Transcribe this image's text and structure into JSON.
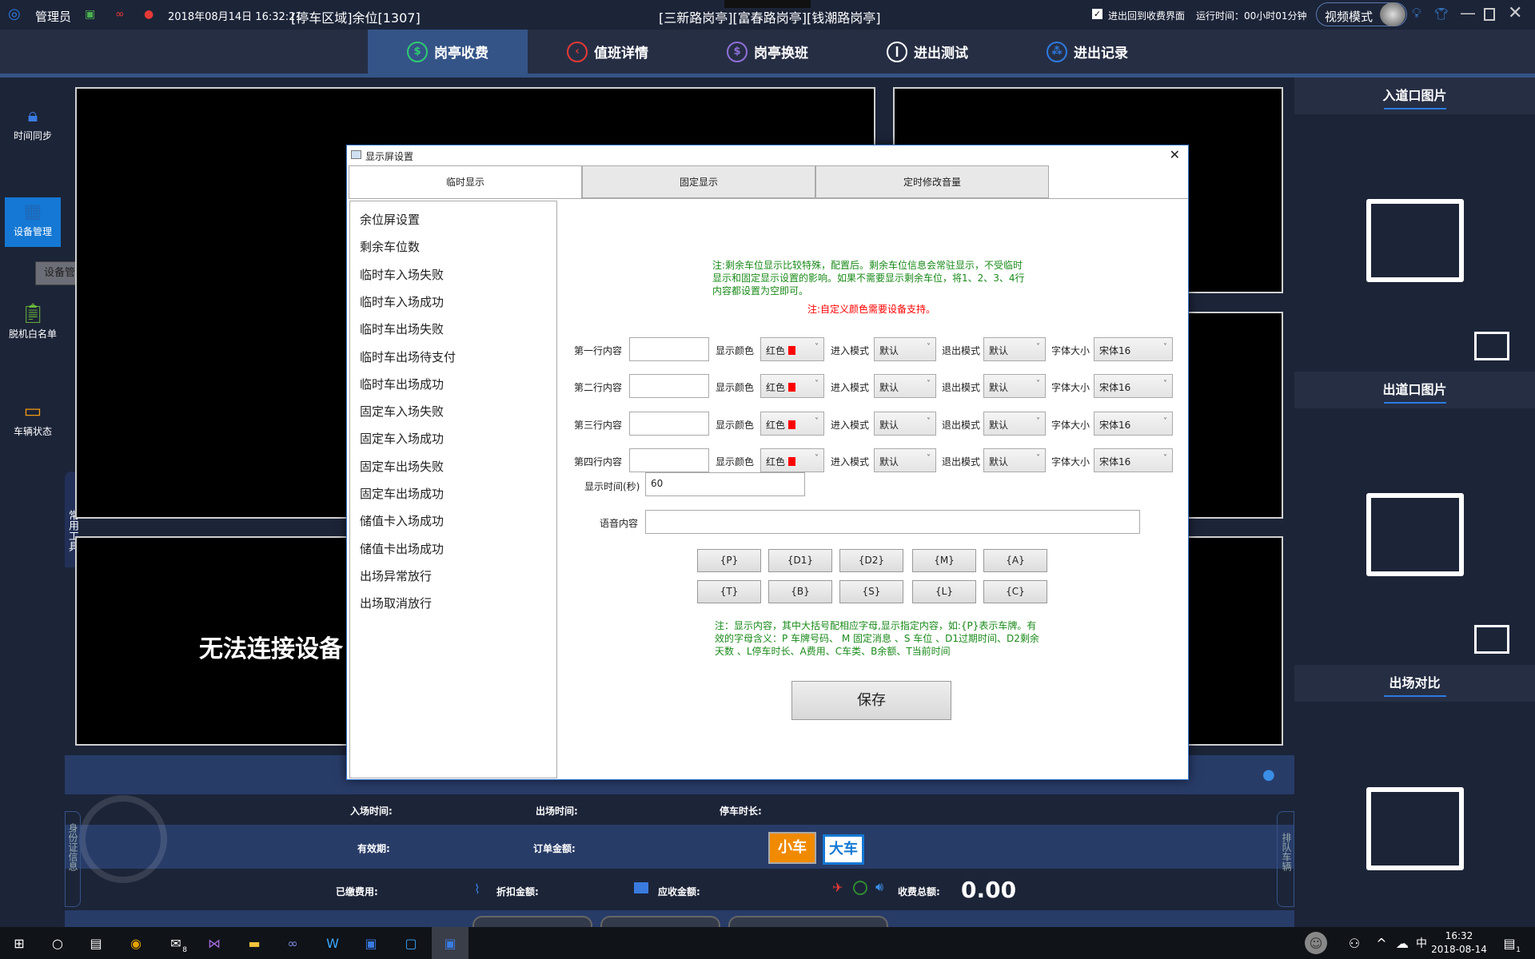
{
  "topbar": {
    "user": "管理员",
    "datetime": "2018年08月14日 16:32:21",
    "area": "[停车区域]余位[1307]",
    "booths": "[三新路岗亭][富春路岗亭][钱潮路岗亭]",
    "return_checkbox": "进出回到收费界面",
    "return_checked": true,
    "runtime": "运行时间：00小时01分钟",
    "mode": "视频模式"
  },
  "nav": {
    "tabs": [
      {
        "label": "岗亭收费",
        "color": "#2ecc71",
        "active": true
      },
      {
        "label": "值班详情",
        "color": "#e53935"
      },
      {
        "label": "岗亭换班",
        "color": "#8e6fd8"
      },
      {
        "label": "进出测试",
        "color": "#ffffff"
      },
      {
        "label": "进出记录",
        "color": "#2d7be0"
      }
    ]
  },
  "sidebar": {
    "items": [
      {
        "label": "时间同步",
        "icon": "lock-clock-icon"
      },
      {
        "label": "设备管理",
        "icon": "device-icon",
        "active": true
      },
      {
        "label": "脱机白名单",
        "icon": "clipboard-check-icon"
      },
      {
        "label": "车辆状态",
        "icon": "card-icon"
      }
    ],
    "tooltip": "设备管理",
    "tools_tab": "常用工具"
  },
  "video": {
    "status": "无法连接设备"
  },
  "rightpanel": {
    "entry": "入道口图片",
    "exit": "出道口图片",
    "compare": "出场对比"
  },
  "bottom": {
    "entry_time": "入场时间:",
    "exit_time": "出场时间:",
    "duration": "停车时长:",
    "validity": "有效期:",
    "order_amount": "订单金额:",
    "small_car": "小车",
    "large_car": "大车",
    "paid": "已缴费用:",
    "discount": "折扣金额:",
    "receivable": "应收金额:",
    "total_label": "收费总额:",
    "total_value": "0.00",
    "id_tab": "身份证信息",
    "queue_tab": "排队车辆"
  },
  "dialog": {
    "title": "显示屏设置",
    "tabs": [
      "临时显示",
      "固定显示",
      "定时修改音量"
    ],
    "list": [
      "余位屏设置",
      "剩余车位数",
      "临时车入场失败",
      "临时车入场成功",
      "临时车出场失败",
      "临时车出场待支付",
      "临时车出场成功",
      "固定车入场失败",
      "固定车入场成功",
      "固定车出场失败",
      "固定车出场成功",
      "储值卡入场成功",
      "储值卡出场成功",
      "出场异常放行",
      "出场取消放行"
    ],
    "note1": "注:剩余车位显示比较特殊，配置后。剩余车位信息会常驻显示，不受临时显示和固定显示设置的影响。如果不需要显示剩余车位，将1、2、3、4行内容都设置为空即可。",
    "note_red": "注:自定义颜色需要设备支持。",
    "rows": [
      {
        "label": "第一行内容",
        "value": "",
        "color": "红色",
        "enter": "默认",
        "exit": "默认",
        "font": "宋体16"
      },
      {
        "label": "第二行内容",
        "value": "",
        "color": "红色",
        "enter": "默认",
        "exit": "默认",
        "font": "宋体16"
      },
      {
        "label": "第三行内容",
        "value": "",
        "color": "红色",
        "enter": "默认",
        "exit": "默认",
        "font": "宋体16"
      },
      {
        "label": "第四行内容",
        "value": "",
        "color": "红色",
        "enter": "默认",
        "exit": "默认",
        "font": "宋体16"
      }
    ],
    "color_label": "显示颜色",
    "enter_label": "进入模式",
    "exit_label": "退出模式",
    "font_label": "字体大小",
    "time_label": "显示时间(秒)",
    "time_value": "60",
    "voice_label": "语音内容",
    "voice_value": "",
    "tokens": [
      "{P}",
      "{D1}",
      "{D2}",
      "{M}",
      "{A}",
      "{T}",
      "{B}",
      "{S}",
      "{L}",
      "{C}"
    ],
    "note2": "注：显示内容，其中大括号配相应字母,显示指定内容，如:{P}表示车牌。有效的字母含义：P 车牌号码、 M 固定消息 、S 车位 、D1过期时间、D2剩余天数 、L停车时长、A费用、C车类、B余额、T当前时间",
    "save": "保存"
  },
  "taskbar": {
    "time": "16:32",
    "date": "2018-08-14",
    "ime": "中",
    "mail_badge": "8",
    "notif_badge": "1"
  }
}
